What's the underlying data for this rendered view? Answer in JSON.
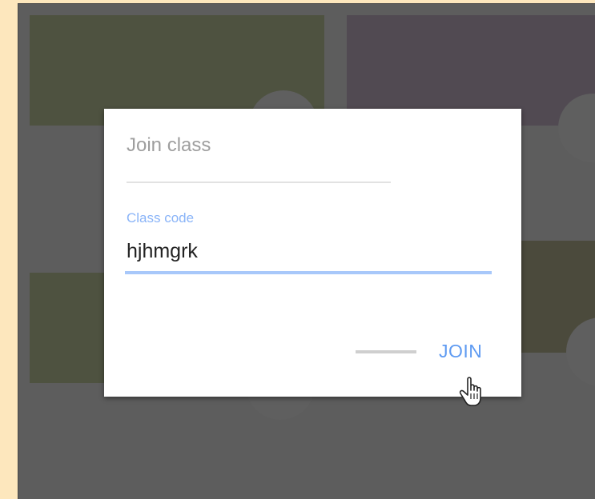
{
  "dialog": {
    "title": "Join class",
    "field_label": "Class code",
    "field_value": "hjhmgrk",
    "join_label": "JOIN"
  },
  "colors": {
    "accent": "#5f9bf2",
    "backdrop": "#5d5d5d",
    "page_bg": "#fde7bd"
  },
  "icons": {
    "cursor": "hand-pointer-icon"
  }
}
